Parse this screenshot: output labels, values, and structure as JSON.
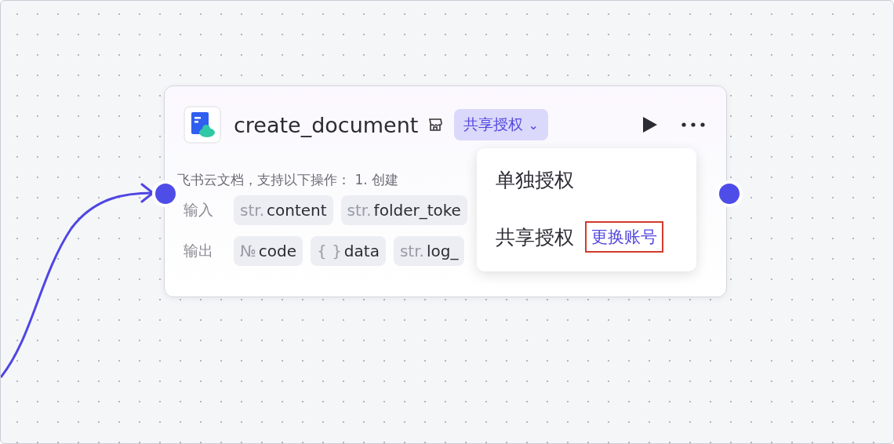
{
  "node": {
    "title": "create_document",
    "auth_badge": {
      "label": "共享授权",
      "caret": "⌄"
    },
    "description": "飞书云文档，支持以下操作： 1. 创建",
    "inputs": {
      "label": "输入",
      "params": [
        {
          "type": "str.",
          "name": "content"
        },
        {
          "type": "str.",
          "name": "folder_toke"
        }
      ]
    },
    "outputs": {
      "label": "输出",
      "params": [
        {
          "type": "№",
          "name": "code"
        },
        {
          "type": "{ }",
          "name": "data"
        },
        {
          "type": "str.",
          "name": "log_"
        }
      ]
    }
  },
  "auth_menu": {
    "items": [
      {
        "label": "单独授权"
      },
      {
        "label": "共享授权",
        "link": {
          "label": "更换账号",
          "annotated": true
        }
      }
    ]
  }
}
